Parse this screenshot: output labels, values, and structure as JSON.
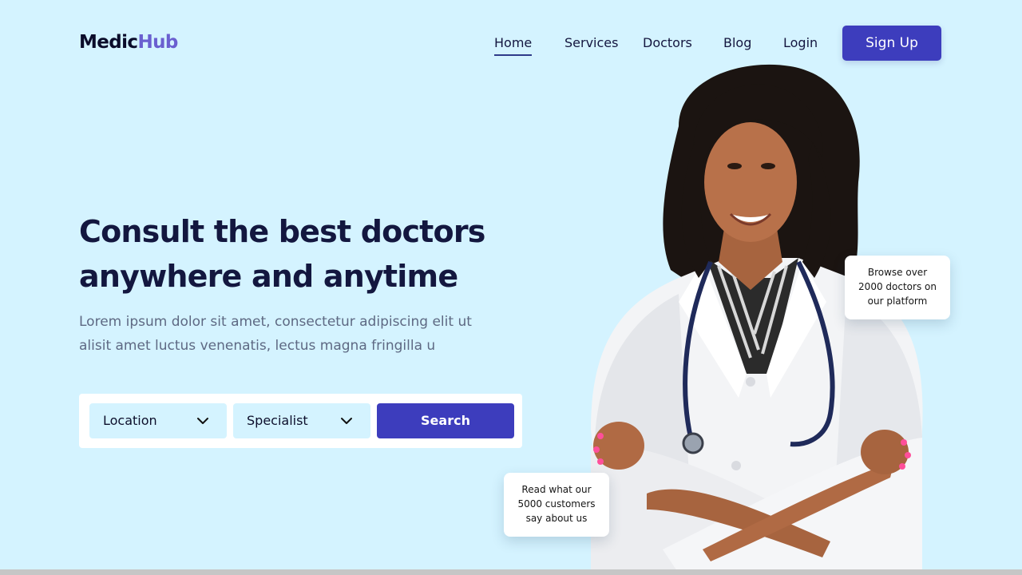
{
  "brand": {
    "part1": "Medic",
    "part2": "Hub"
  },
  "nav": {
    "items": [
      {
        "label": "Home",
        "active": true
      },
      {
        "label": "Services",
        "active": false
      },
      {
        "label": "Doctors",
        "active": false
      },
      {
        "label": "Blog",
        "active": false
      },
      {
        "label": "Login",
        "active": false
      }
    ],
    "signup_label": "Sign Up"
  },
  "hero": {
    "title_lines": [
      "Consult the best doctors",
      "anywhere and anytime"
    ],
    "desc_lines": [
      "Lorem ipsum dolor sit amet, consectetur adipiscing elit ut",
      "alisit amet luctus venenatis, lectus magna fringilla u"
    ]
  },
  "search": {
    "location_label": "Location",
    "specialist_label": "Specialist",
    "button_label": "Search"
  },
  "cards": {
    "doctors_lines": [
      "Browse over",
      "2000 doctors on",
      "our platform"
    ],
    "customers_lines": [
      "Read what our",
      "5000 customers",
      "say about us"
    ]
  },
  "colors": {
    "background": "#d4f3ff",
    "primary": "#3d3dbd",
    "brand_accent": "#6a5fd0",
    "heading": "#13173f"
  }
}
